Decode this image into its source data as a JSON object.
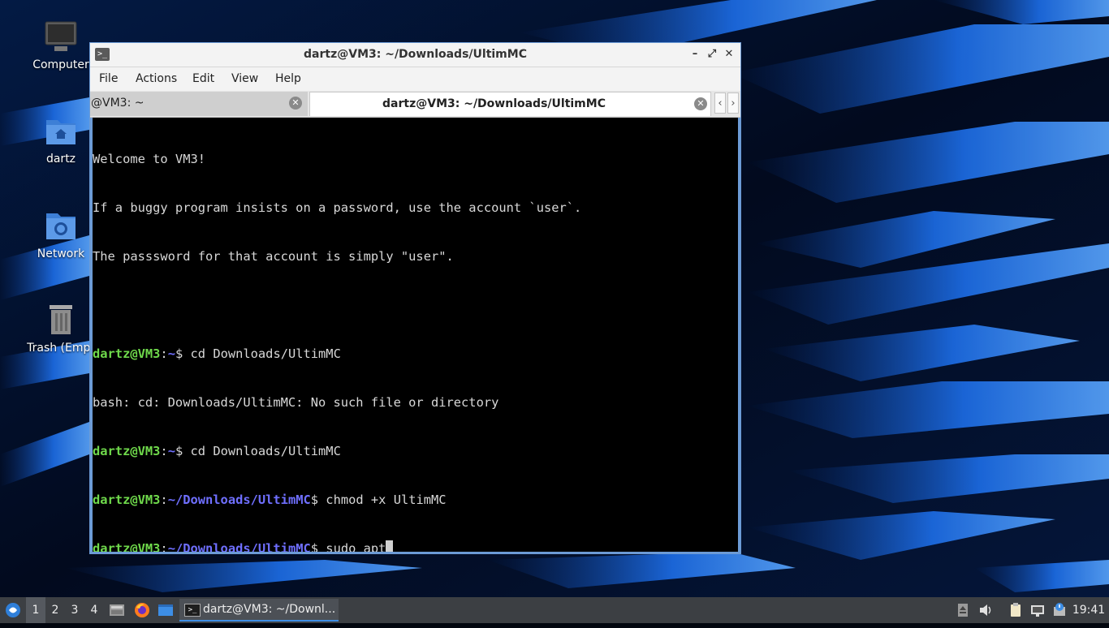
{
  "desktop": {
    "icons": [
      {
        "label": "Computer",
        "icon": "computer-icon"
      },
      {
        "label": "dartz",
        "icon": "home-folder-icon"
      },
      {
        "label": "Network",
        "icon": "network-folder-icon"
      },
      {
        "label": "Trash (Empt",
        "icon": "trash-icon"
      }
    ]
  },
  "window": {
    "title": "dartz@VM3: ~/Downloads/UltimMC",
    "buttons": {
      "minimize": "–",
      "maximize": "⤢",
      "close": "✕"
    },
    "menu": [
      "File",
      "Actions",
      "Edit",
      "View",
      "Help"
    ],
    "tabs": [
      {
        "label": "@VM3: ~",
        "active": false
      },
      {
        "label": "dartz@VM3: ~/Downloads/UltimMC",
        "active": true
      }
    ],
    "tab_nav": {
      "prev": "‹",
      "next": "›"
    }
  },
  "terminal": {
    "lines": [
      {
        "type": "text",
        "text": "Welcome to VM3!"
      },
      {
        "type": "text",
        "text": "If a buggy program insists on a password, use the account `user`."
      },
      {
        "type": "text",
        "text": "The passsword for that account is simply \"user\"."
      },
      {
        "type": "text",
        "text": ""
      },
      {
        "type": "prompt",
        "user": "dartz@VM3",
        "sep": ":",
        "path": "~",
        "dollar": "$ ",
        "cmd": "cd Downloads/UltimMC"
      },
      {
        "type": "text",
        "text": "bash: cd: Downloads/UltimMC: No such file or directory"
      },
      {
        "type": "prompt",
        "user": "dartz@VM3",
        "sep": ":",
        "path": "~",
        "dollar": "$ ",
        "cmd": "cd Downloads/UltimMC"
      },
      {
        "type": "prompt",
        "user": "dartz@VM3",
        "sep": ":",
        "path": "~/Downloads/UltimMC",
        "dollar": "$ ",
        "cmd": "chmod +x UltimMC"
      },
      {
        "type": "prompt",
        "user": "dartz@VM3",
        "sep": ":",
        "path": "~/Downloads/UltimMC",
        "dollar": "$ ",
        "cmd": "sudo apt",
        "cursor": true
      }
    ],
    "colors": {
      "user": "#6fd94b",
      "path": "#6f6fff",
      "text": "#d8d8d8",
      "background": "#000000"
    }
  },
  "taskbar": {
    "workspaces": [
      "1",
      "2",
      "3",
      "4"
    ],
    "active_workspace": "1",
    "launchers": [
      "file-manager-icon",
      "firefox-icon",
      "show-desktop-icon"
    ],
    "task_label": "dartz@VM3: ~/Downl...",
    "tray": [
      "removable-media-icon",
      "volume-icon",
      "clipboard-icon",
      "network-icon",
      "updates-icon"
    ],
    "clock": "19:41"
  }
}
